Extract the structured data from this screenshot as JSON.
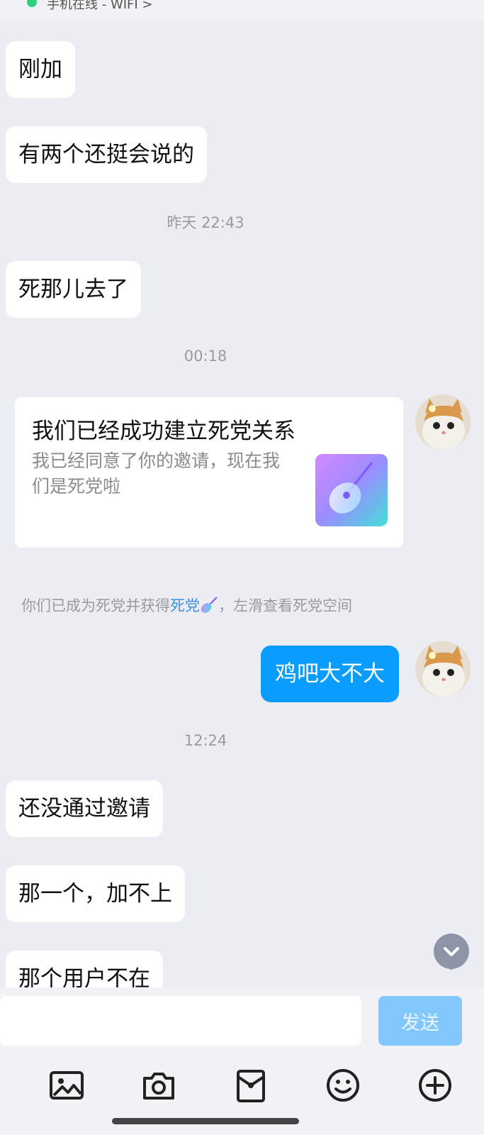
{
  "status": {
    "online_text": "手机在线 - WIFI >"
  },
  "messages": {
    "m1": "刚加",
    "m2": "有两个还挺会说的",
    "t1": "昨天 22:43",
    "m3": "死那儿去了",
    "t2": "00:18",
    "card": {
      "title": "我们已经成功建立死党关系",
      "desc": "我已经同意了你的邀请，现在我们是死党啦"
    },
    "notice_pre": "你们已成为死党并获得",
    "notice_link": "死党",
    "notice_post": "，左滑查看死党空间",
    "m4_self": "鸡吧大不大",
    "t3": "12:24",
    "m5": "还没通过邀请",
    "m6": "那一个，加不上",
    "m7": "那个用户不在"
  },
  "input": {
    "placeholder": "",
    "send_label": "发送"
  },
  "toolbar": {
    "icons": [
      "image-icon",
      "camera-icon",
      "red-packet-icon",
      "emoji-icon",
      "plus-icon"
    ]
  },
  "colors": {
    "self_bubble": "#0a9cff",
    "send_disabled": "#82c8ff",
    "link": "#3a8ee6"
  }
}
